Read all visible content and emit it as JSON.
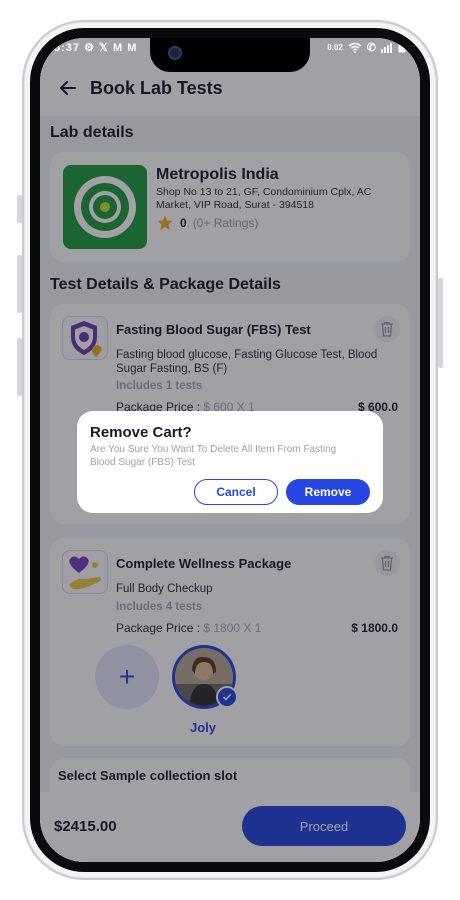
{
  "status_bar": {
    "time": "5:37",
    "network_speed": "0.02",
    "icons": [
      "settings-icon",
      "x-icon",
      "mail-icon",
      "mail-icon",
      "wifi-icon",
      "call-icon",
      "signal-icon",
      "battery-icon"
    ]
  },
  "header": {
    "title": "Book Lab Tests",
    "back_icon": "back-arrow-icon"
  },
  "lab_section": {
    "title": "Lab details",
    "name": "Metropolis India",
    "address": "Shop No 13 to 21, GF, Condominium Cplx, AC Market, VIP Road, Surat - 394518",
    "rating_value": "0",
    "rating_text": "(0+ Ratings)"
  },
  "tests_section": {
    "title": "Test Details & Package Details",
    "packages": [
      {
        "title": "Fasting Blood Sugar (FBS) Test",
        "description": "Fasting blood glucose, Fasting Glucose Test, Blood Sugar Fasting, BS (F)",
        "includes": "Includes 1 tests",
        "price_label": "Package Price : ",
        "price_detail": "$ 600 X 1",
        "total": "$ 600.0"
      },
      {
        "title": "Complete Wellness Package",
        "description": "Full Body Checkup",
        "includes": "Includes 4 tests",
        "price_label": "Package Price : ",
        "price_detail": "$ 1800 X 1",
        "total": "$ 1800.0",
        "member_name": "Joly"
      }
    ]
  },
  "slot_section": {
    "title": "Select Sample collection slot"
  },
  "footer": {
    "total": "$2415.00",
    "proceed_label": "Proceed"
  },
  "dialog": {
    "title": "Remove Cart?",
    "message": "Are You Sure You Want To Delete All Item From Fasting Blood Sugar (FBS) Test",
    "cancel_label": "Cancel",
    "remove_label": "Remove"
  },
  "colors": {
    "accent": "#2747e0",
    "lab_logo": "#1f9b3f",
    "star": "#f2b01e",
    "overlay": "rgba(20,20,30,0.40)"
  }
}
